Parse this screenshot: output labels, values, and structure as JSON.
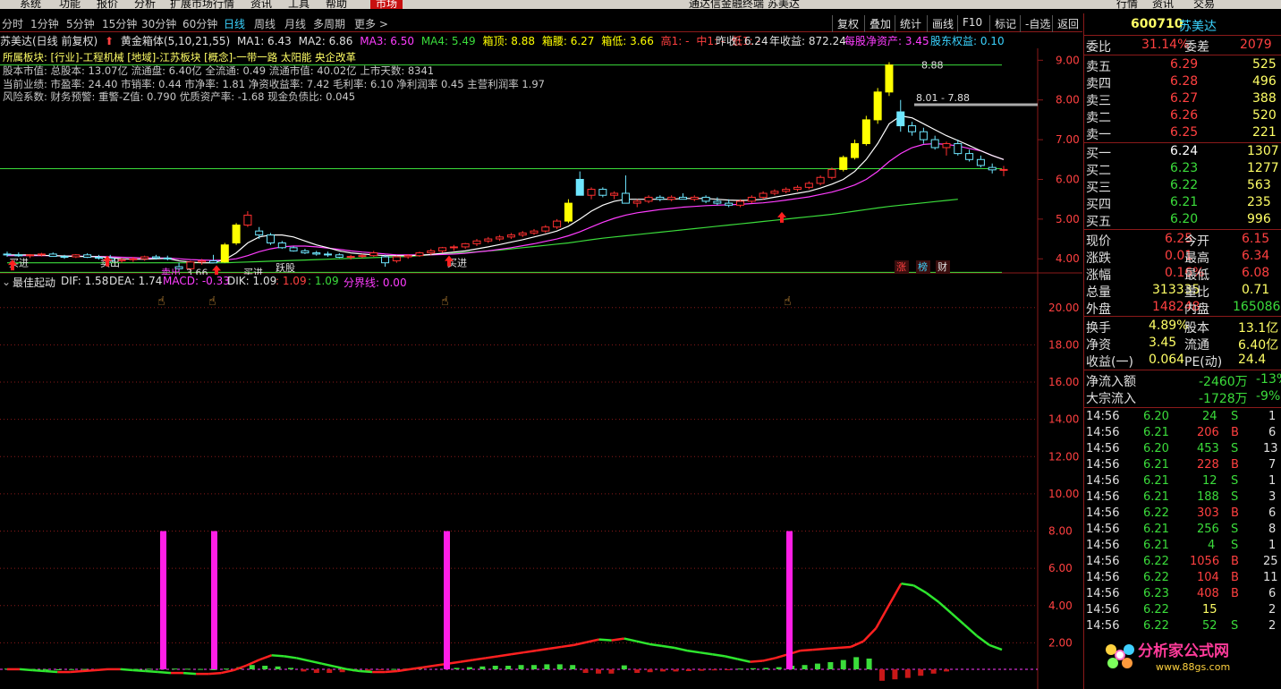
{
  "menu": {
    "items": [
      "系统",
      "功能",
      "报价",
      "分析",
      "扩展市场行情",
      "资讯",
      "工具",
      "帮助"
    ],
    "active": "市场",
    "title": "通达信金融终端 苏美达",
    "right": [
      "行情",
      "资讯",
      "交易"
    ]
  },
  "periods": [
    "分时",
    "1分钟",
    "5分钟",
    "15分钟",
    "30分钟",
    "60分钟",
    "日线",
    "周线",
    "月线",
    "多周期",
    "更多 >"
  ],
  "toolbar": [
    "复权",
    "叠加",
    "统计",
    "画线",
    "F10",
    "标记",
    "-自选",
    "返回"
  ],
  "info": {
    "name": "苏美达(日线 前复权)",
    "indicator": "黄金箱体(5,10,21,55)",
    "ma1": "MA1: 6.43",
    "ma2": "MA2: 6.86",
    "ma3": "MA3: 6.50",
    "ma4": "MA4: 5.49",
    "box_top": "箱顶: 8.88",
    "box_mid": "箱腰: 6.27",
    "box_low": "箱低: 3.66",
    "hi": "高1: -",
    "mid": "中1: -",
    "low": "低1: -",
    "prev_close": "昨收: 6.24",
    "annual": "年收益: 872.24",
    "nav": "每股净资产: 3.45",
    "equity": "股东权益: 0.10"
  },
  "fin": [
    "所属板块: [行业]-工程机械 [地域]-江苏板块 [概念]-一带一路 太阳能 央企改革",
    "股本市值: 总股本: 13.07亿 流通盘: 6.40亿 全流通: 0.49 流通市值: 40.02亿 上市天数: 8341",
    "当前业绩: 市盈率: 24.40 市销率: 0.44 市净率: 1.81 净资收益率: 7.42 毛利率: 6.10 净利润率 0.45 主营利润率 1.97",
    "风险系数: 财务预警: 重警-Z值: 0.790 优质资产率: -1.68 现金负债比: 0.045"
  ],
  "chart_data": {
    "type": "candlestick",
    "ylim": [
      3.6,
      9.3
    ],
    "y_ticks": [
      "9.00",
      "8.00",
      "7.00",
      "6.00",
      "5.00",
      "4.00"
    ],
    "candles": [
      [
        4.12,
        4.18,
        4.05,
        4.1
      ],
      [
        4.1,
        4.16,
        4.05,
        4.08
      ],
      [
        4.08,
        4.12,
        4.02,
        4.1
      ],
      [
        4.1,
        4.15,
        4.06,
        4.12
      ],
      [
        4.12,
        4.16,
        4.05,
        4.06
      ],
      [
        4.06,
        4.1,
        4.0,
        4.05
      ],
      [
        4.05,
        4.12,
        4.02,
        4.1
      ],
      [
        4.1,
        4.14,
        4.02,
        4.04
      ],
      [
        4.04,
        4.1,
        3.98,
        4.02
      ],
      [
        4.02,
        4.1,
        3.9,
        3.95
      ],
      [
        3.95,
        4.02,
        3.9,
        3.98
      ],
      [
        3.98,
        4.05,
        3.92,
        4.0
      ],
      [
        4.0,
        4.08,
        3.95,
        4.05
      ],
      [
        4.05,
        4.1,
        3.98,
        4.02
      ],
      [
        4.02,
        4.08,
        3.96,
        4.0
      ],
      [
        3.8,
        3.9,
        3.7,
        3.75
      ],
      [
        3.75,
        3.95,
        3.7,
        3.92
      ],
      [
        3.92,
        4.0,
        3.85,
        3.95
      ],
      [
        3.95,
        4.1,
        3.9,
        3.9
      ],
      [
        3.92,
        4.4,
        3.9,
        4.35
      ],
      [
        4.4,
        4.9,
        4.35,
        4.85
      ],
      [
        4.85,
        5.2,
        4.8,
        5.1
      ],
      [
        4.7,
        4.8,
        4.5,
        4.6
      ],
      [
        4.6,
        4.65,
        4.35,
        4.4
      ],
      [
        4.4,
        4.45,
        4.25,
        4.28
      ],
      [
        4.28,
        4.32,
        4.18,
        4.2
      ],
      [
        4.2,
        4.25,
        4.12,
        4.15
      ],
      [
        4.15,
        4.2,
        4.08,
        4.12
      ],
      [
        4.12,
        4.18,
        4.05,
        4.1
      ],
      [
        4.1,
        4.14,
        4.02,
        4.04
      ],
      [
        4.04,
        4.1,
        3.98,
        4.06
      ],
      [
        4.06,
        4.12,
        4.02,
        4.08
      ],
      [
        4.08,
        4.2,
        4.05,
        4.15
      ],
      [
        4.05,
        4.1,
        3.8,
        3.9
      ],
      [
        3.95,
        4.08,
        3.9,
        4.05
      ],
      [
        4.05,
        4.12,
        4.0,
        4.08
      ],
      [
        4.08,
        4.18,
        4.05,
        4.15
      ],
      [
        4.15,
        4.25,
        4.1,
        4.2
      ],
      [
        4.2,
        4.3,
        4.15,
        4.28
      ],
      [
        4.28,
        4.35,
        4.2,
        4.3
      ],
      [
        4.3,
        4.4,
        4.25,
        4.38
      ],
      [
        4.38,
        4.5,
        4.32,
        4.45
      ],
      [
        4.45,
        4.55,
        4.4,
        4.5
      ],
      [
        4.5,
        4.6,
        4.45,
        4.55
      ],
      [
        4.55,
        4.65,
        4.5,
        4.6
      ],
      [
        4.6,
        4.7,
        4.55,
        4.65
      ],
      [
        4.65,
        4.75,
        4.6,
        4.7
      ],
      [
        4.7,
        4.85,
        4.65,
        4.8
      ],
      [
        4.8,
        5.0,
        4.75,
        4.95
      ],
      [
        4.95,
        5.5,
        4.9,
        5.4
      ],
      [
        6.0,
        6.2,
        5.8,
        5.6
      ],
      [
        5.6,
        5.8,
        5.5,
        5.75
      ],
      [
        5.75,
        5.8,
        5.55,
        5.6
      ],
      [
        5.6,
        5.7,
        5.5,
        5.65
      ],
      [
        5.65,
        6.1,
        5.5,
        5.4
      ],
      [
        5.4,
        5.5,
        5.3,
        5.45
      ],
      [
        5.45,
        5.6,
        5.4,
        5.55
      ],
      [
        5.55,
        5.6,
        5.45,
        5.5
      ],
      [
        5.5,
        5.6,
        5.45,
        5.55
      ],
      [
        5.55,
        5.65,
        5.5,
        5.5
      ],
      [
        5.5,
        5.6,
        5.45,
        5.55
      ],
      [
        5.55,
        5.6,
        5.4,
        5.45
      ],
      [
        5.45,
        5.55,
        5.35,
        5.4
      ],
      [
        5.4,
        5.5,
        5.3,
        5.35
      ],
      [
        5.35,
        5.5,
        5.3,
        5.45
      ],
      [
        5.45,
        5.6,
        5.4,
        5.55
      ],
      [
        5.55,
        5.7,
        5.5,
        5.65
      ],
      [
        5.65,
        5.75,
        5.6,
        5.7
      ],
      [
        5.7,
        5.8,
        5.65,
        5.75
      ],
      [
        5.75,
        5.85,
        5.7,
        5.8
      ],
      [
        5.8,
        5.95,
        5.75,
        5.9
      ],
      [
        5.9,
        6.1,
        5.85,
        6.05
      ],
      [
        6.05,
        6.3,
        6.0,
        6.25
      ],
      [
        6.25,
        6.6,
        6.2,
        6.55
      ],
      [
        6.55,
        7.0,
        6.5,
        6.9
      ],
      [
        6.9,
        7.6,
        6.85,
        7.5
      ],
      [
        7.5,
        8.3,
        7.4,
        8.2
      ],
      [
        8.2,
        8.95,
        8.1,
        8.88
      ],
      [
        7.7,
        8.0,
        7.2,
        7.35
      ],
      [
        7.35,
        7.45,
        7.1,
        7.2
      ],
      [
        7.2,
        7.3,
        6.9,
        7.0
      ],
      [
        7.0,
        7.1,
        6.75,
        6.8
      ],
      [
        6.8,
        6.95,
        6.6,
        6.9
      ],
      [
        6.9,
        7.0,
        6.6,
        6.65
      ],
      [
        6.65,
        6.75,
        6.45,
        6.5
      ],
      [
        6.5,
        6.6,
        6.3,
        6.35
      ],
      [
        6.3,
        6.4,
        6.15,
        6.24
      ],
      [
        6.24,
        6.34,
        6.08,
        6.25
      ]
    ],
    "ma_white": [
      4.1,
      4.1,
      4.1,
      4.09,
      4.08,
      4.07,
      4.06,
      4.06,
      4.05,
      4.03,
      4.0,
      3.99,
      3.99,
      4.0,
      4.01,
      3.95,
      3.92,
      3.9,
      3.9,
      3.98,
      4.15,
      4.4,
      4.55,
      4.6,
      4.6,
      4.55,
      4.45,
      4.35,
      4.28,
      4.2,
      4.15,
      4.12,
      4.1,
      4.08,
      4.08,
      4.08,
      4.09,
      4.11,
      4.14,
      4.17,
      4.2,
      4.25,
      4.3,
      4.36,
      4.42,
      4.48,
      4.55,
      4.62,
      4.7,
      4.82,
      5.0,
      5.2,
      5.35,
      5.45,
      5.5,
      5.5,
      5.5,
      5.5,
      5.5,
      5.52,
      5.52,
      5.52,
      5.5,
      5.48,
      5.47,
      5.48,
      5.5,
      5.55,
      5.6,
      5.65,
      5.7,
      5.78,
      5.88,
      6.0,
      6.2,
      6.5,
      6.9,
      7.4,
      7.6,
      7.55,
      7.4,
      7.25,
      7.1,
      6.98,
      6.85,
      6.72,
      6.6,
      6.5
    ],
    "ma_magenta": [
      4.08,
      4.08,
      4.08,
      4.08,
      4.08,
      4.07,
      4.07,
      4.06,
      4.06,
      4.05,
      4.04,
      4.03,
      4.02,
      4.02,
      4.02,
      4.0,
      3.98,
      3.97,
      3.96,
      3.97,
      4.0,
      4.08,
      4.18,
      4.25,
      4.3,
      4.32,
      4.32,
      4.3,
      4.27,
      4.24,
      4.2,
      4.17,
      4.15,
      4.12,
      4.1,
      4.1,
      4.1,
      4.1,
      4.11,
      4.12,
      4.14,
      4.17,
      4.2,
      4.24,
      4.28,
      4.33,
      4.38,
      4.44,
      4.5,
      4.58,
      4.68,
      4.8,
      4.92,
      5.02,
      5.1,
      5.16,
      5.2,
      5.24,
      5.27,
      5.3,
      5.32,
      5.34,
      5.35,
      5.36,
      5.37,
      5.39,
      5.41,
      5.44,
      5.48,
      5.52,
      5.56,
      5.62,
      5.68,
      5.76,
      5.86,
      6.0,
      6.2,
      6.45,
      6.65,
      6.8,
      6.88,
      6.9,
      6.88,
      6.84,
      6.78,
      6.72,
      6.6,
      6.5
    ],
    "ma_green": [
      3.9,
      3.9,
      3.9,
      3.9,
      3.9,
      3.9,
      3.9,
      3.9,
      3.9,
      3.9,
      3.9,
      3.9,
      3.9,
      3.9,
      3.9,
      3.9,
      3.9,
      3.9,
      3.9,
      3.9,
      3.91,
      3.92,
      3.93,
      3.94,
      3.95,
      3.96,
      3.97,
      3.98,
      3.99,
      4.0,
      4.01,
      4.02,
      4.03,
      4.04,
      4.05,
      4.06,
      4.08,
      4.1,
      4.12,
      4.14,
      4.16,
      4.18,
      4.2,
      4.22,
      4.25,
      4.28,
      4.31,
      4.34,
      4.37,
      4.4,
      4.44,
      4.48,
      4.52,
      4.55,
      4.58,
      4.61,
      4.64,
      4.67,
      4.7,
      4.73,
      4.76,
      4.79,
      4.82,
      4.85,
      4.88,
      4.91,
      4.94,
      4.97,
      5.0,
      5.03,
      5.06,
      5.09,
      5.12,
      5.16,
      5.2,
      5.24,
      5.28,
      5.32,
      5.35,
      5.38,
      5.41,
      5.44,
      5.47,
      5.5
    ],
    "hlines": [
      {
        "value": 8.88,
        "color": "#3bdc3b"
      },
      {
        "value": 6.27,
        "color": "#3bdc3b"
      },
      {
        "value": 3.66,
        "color": "#3bdc3b"
      },
      {
        "value": 7.88,
        "color": "#aaaaaa"
      }
    ],
    "annotations": [
      "8.88",
      "8.01 - 7.88",
      "3.66"
    ],
    "tags": [
      "买进",
      "卖出",
      "买进",
      "买进",
      "跃股",
      "卖出",
      "涨",
      "榜",
      "财"
    ]
  },
  "indicator_data": {
    "type": "indicator",
    "title": "最佳起动",
    "dif": "DIF: 1.58",
    "dea": "DEA: 1.74",
    "macd": "MACD: -0.33",
    "dik": "DIK: 1.09",
    "v1": ": 1.09",
    "v2": ": 1.09",
    "fenjie": "分界线: 0.00",
    "ylim": [
      0,
      21
    ],
    "y_ticks": [
      "20.00",
      "18.00",
      "16.00",
      "14.00",
      "12.00",
      "10.00",
      "8.00",
      "6.00",
      "4.00",
      "2.00"
    ],
    "signals": [
      {
        "index": 22,
        "value": 8.0
      },
      {
        "index": 27,
        "value": 8.0
      },
      {
        "index": 56,
        "value": 8.0
      },
      {
        "index": 89,
        "value": 8.0
      }
    ],
    "line": [
      0.1,
      0.1,
      0.05,
      0.0,
      -0.05,
      -0.05,
      0.0,
      0.05,
      0.1,
      0.1,
      0.05,
      0.0,
      -0.05,
      -0.1,
      -0.1,
      -0.15,
      -0.15,
      -0.1,
      0.05,
      0.3,
      0.6,
      0.85,
      0.8,
      0.7,
      0.55,
      0.4,
      0.25,
      0.1,
      0.0,
      -0.05,
      -0.05,
      0.0,
      0.1,
      0.2,
      0.3,
      0.4,
      0.5,
      0.6,
      0.7,
      0.8,
      0.9,
      1.0,
      1.1,
      1.2,
      1.3,
      1.4,
      1.55,
      1.7,
      1.65,
      1.75,
      1.6,
      1.45,
      1.35,
      1.25,
      1.1,
      1.0,
      0.9,
      0.8,
      0.65,
      0.5,
      0.55,
      0.7,
      0.9,
      1.1,
      1.15,
      1.2,
      1.25,
      1.3,
      1.6,
      2.3,
      3.5,
      4.7,
      4.6,
      4.2,
      3.7,
      3.1,
      2.5,
      1.9,
      1.4,
      1.15
    ],
    "bars": [
      0.1,
      0.08,
      0.05,
      0.02,
      0.0,
      0.03,
      0.05,
      0.04,
      0.02,
      0.0,
      0.05,
      0.08,
      0.1,
      0.1,
      0.08,
      0.05,
      0.0,
      0.1,
      0.3,
      0.6,
      0.5,
      0.4,
      0.2,
      -0.3,
      -0.5,
      -0.5,
      -0.4,
      -0.3,
      -0.2,
      -0.1,
      0.05,
      0.1,
      0.15,
      0.2,
      0.3,
      0.4,
      0.5,
      0.5,
      0.6,
      0.6,
      0.7,
      0.7,
      0.6,
      -0.5,
      -0.6,
      -0.6,
      0.55,
      -0.5,
      -0.4,
      -0.3,
      -0.3,
      -0.25,
      -0.2,
      -0.15,
      -0.1,
      0.1,
      0.15,
      0.2,
      0.3,
      0.5,
      0.6,
      0.8,
      1.0,
      1.3,
      1.7,
      1.5,
      -1.6,
      -1.4,
      -1.2,
      -0.9,
      -0.6,
      -0.3
    ]
  },
  "right": {
    "code": "600710",
    "name": "苏美达",
    "weibi": {
      "l": "委比",
      "v": "31.14%",
      "l2": "委差",
      "v2": "2079"
    },
    "asks": [
      {
        "l": "卖五",
        "p": "6.29",
        "v": "525"
      },
      {
        "l": "卖四",
        "p": "6.28",
        "v": "496"
      },
      {
        "l": "卖三",
        "p": "6.27",
        "v": "388"
      },
      {
        "l": "卖二",
        "p": "6.26",
        "v": "520"
      },
      {
        "l": "卖一",
        "p": "6.25",
        "v": "221"
      }
    ],
    "bids": [
      {
        "l": "买一",
        "p": "6.24",
        "v": "1307"
      },
      {
        "l": "买二",
        "p": "6.23",
        "v": "1277"
      },
      {
        "l": "买三",
        "p": "6.22",
        "v": "563"
      },
      {
        "l": "买四",
        "p": "6.21",
        "v": "235"
      },
      {
        "l": "买五",
        "p": "6.20",
        "v": "996"
      }
    ],
    "stats": [
      {
        "l": "现价",
        "v": "6.25",
        "l2": "今开",
        "v2": "6.15"
      },
      {
        "l": "涨跌",
        "v": "0.01",
        "l2": "最高",
        "v2": "6.34"
      },
      {
        "l": "涨幅",
        "v": "0.16%",
        "l2": "最低",
        "v2": "6.08"
      },
      {
        "l": "总量",
        "v": "313335",
        "l2": "量比",
        "v2": "0.71"
      },
      {
        "l": "外盘",
        "v": "148248",
        "l2": "内盘",
        "v2": "165086"
      }
    ],
    "stats2": [
      {
        "l": "换手",
        "v": "4.89%",
        "l2": "股本",
        "v2": "13.1亿"
      },
      {
        "l": "净资",
        "v": "3.45",
        "l2": "流通",
        "v2": "6.40亿"
      },
      {
        "l": "收益(一)",
        "v": "0.064",
        "l2": "PE(动)",
        "v2": "24.4"
      }
    ],
    "flows": [
      {
        "l": "净流入额",
        "v": "-2460万",
        "p": "-13%"
      },
      {
        "l": "大宗流入",
        "v": "-1728万",
        "p": "-9%"
      }
    ],
    "ticks": [
      {
        "t": "14:56",
        "p": "6.20",
        "v": "24",
        "s": "S",
        "n": "1"
      },
      {
        "t": "14:56",
        "p": "6.21",
        "v": "206",
        "s": "B",
        "n": "6"
      },
      {
        "t": "14:56",
        "p": "6.20",
        "v": "453",
        "s": "S",
        "n": "13"
      },
      {
        "t": "14:56",
        "p": "6.21",
        "v": "228",
        "s": "B",
        "n": "7"
      },
      {
        "t": "14:56",
        "p": "6.21",
        "v": "12",
        "s": "S",
        "n": "1"
      },
      {
        "t": "14:56",
        "p": "6.21",
        "v": "188",
        "s": "S",
        "n": "3"
      },
      {
        "t": "14:56",
        "p": "6.22",
        "v": "303",
        "s": "B",
        "n": "6"
      },
      {
        "t": "14:56",
        "p": "6.21",
        "v": "256",
        "s": "S",
        "n": "8"
      },
      {
        "t": "14:56",
        "p": "6.21",
        "v": "4",
        "s": "S",
        "n": "1"
      },
      {
        "t": "14:56",
        "p": "6.22",
        "v": "1056",
        "s": "B",
        "n": "25"
      },
      {
        "t": "14:56",
        "p": "6.22",
        "v": "104",
        "s": "B",
        "n": "11"
      },
      {
        "t": "14:56",
        "p": "6.23",
        "v": "408",
        "s": "B",
        "n": "6"
      },
      {
        "t": "14:56",
        "p": "6.22",
        "v": "15",
        "s": "",
        "n": "2"
      },
      {
        "t": "14:56",
        "p": "6.22",
        "v": "52",
        "s": "S",
        "n": "2"
      }
    ]
  },
  "watermark": {
    "text": "分析家公式网",
    "url": "www.88gs.com"
  }
}
